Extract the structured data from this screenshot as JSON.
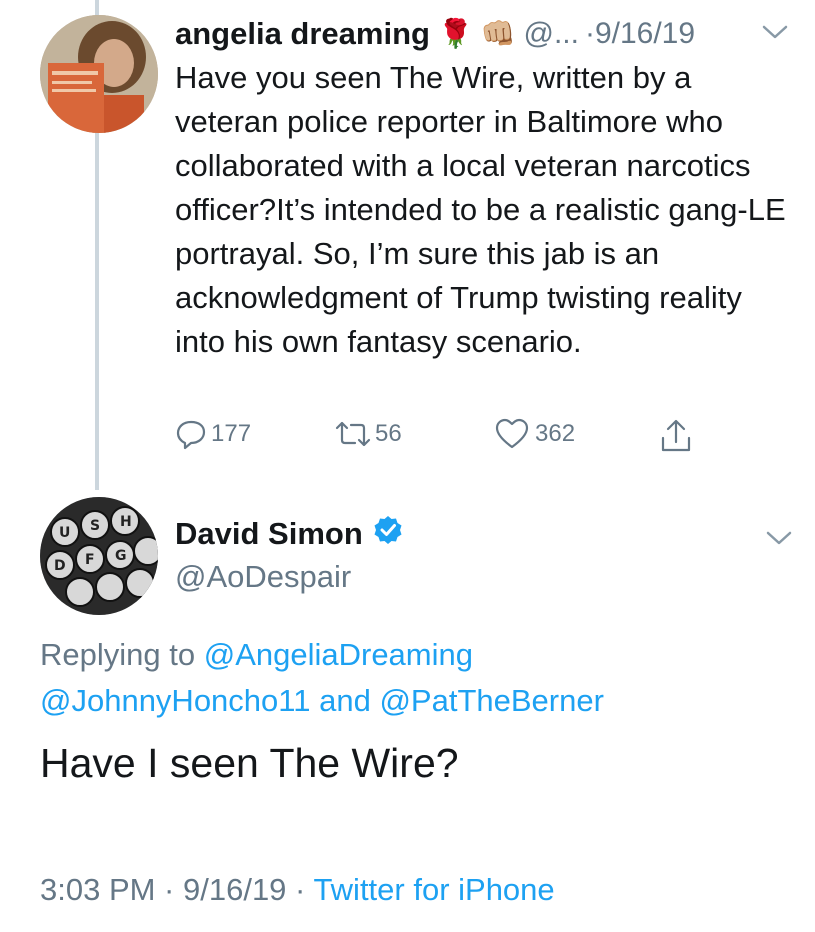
{
  "tweet1": {
    "author_name": "angelia dreaming",
    "emojis": "🌹 👊🏼",
    "handle": "@...",
    "date": "·9/16/19",
    "text": "Have you seen The Wire, written by a veteran police reporter in Baltimore who collaborated with a local veteran narcotics officer?It’s intended to be a realistic gang-LE portrayal. So, I’m sure this jab is an acknowledgment of Trump twisting reality into his own fantasy scenario.",
    "replies": "177",
    "retweets": "56",
    "likes": "362"
  },
  "tweet2": {
    "author_name": "David Simon",
    "handle": "@AoDespair",
    "replying_prefix": "Replying to",
    "replying_to_1": "@AngeliaDreaming",
    "replying_to_2": "@JohnnyHoncho11",
    "replying_and": "and",
    "replying_to_3": "@PatTheBerner",
    "text": "Have I seen The Wire?",
    "time": "3:03 PM · 9/16/19 ·",
    "source": "Twitter for iPhone"
  },
  "colors": {
    "link_blue": "#1da1f2",
    "secondary_gray": "#657786",
    "thread_line": "#ccd6dd"
  }
}
